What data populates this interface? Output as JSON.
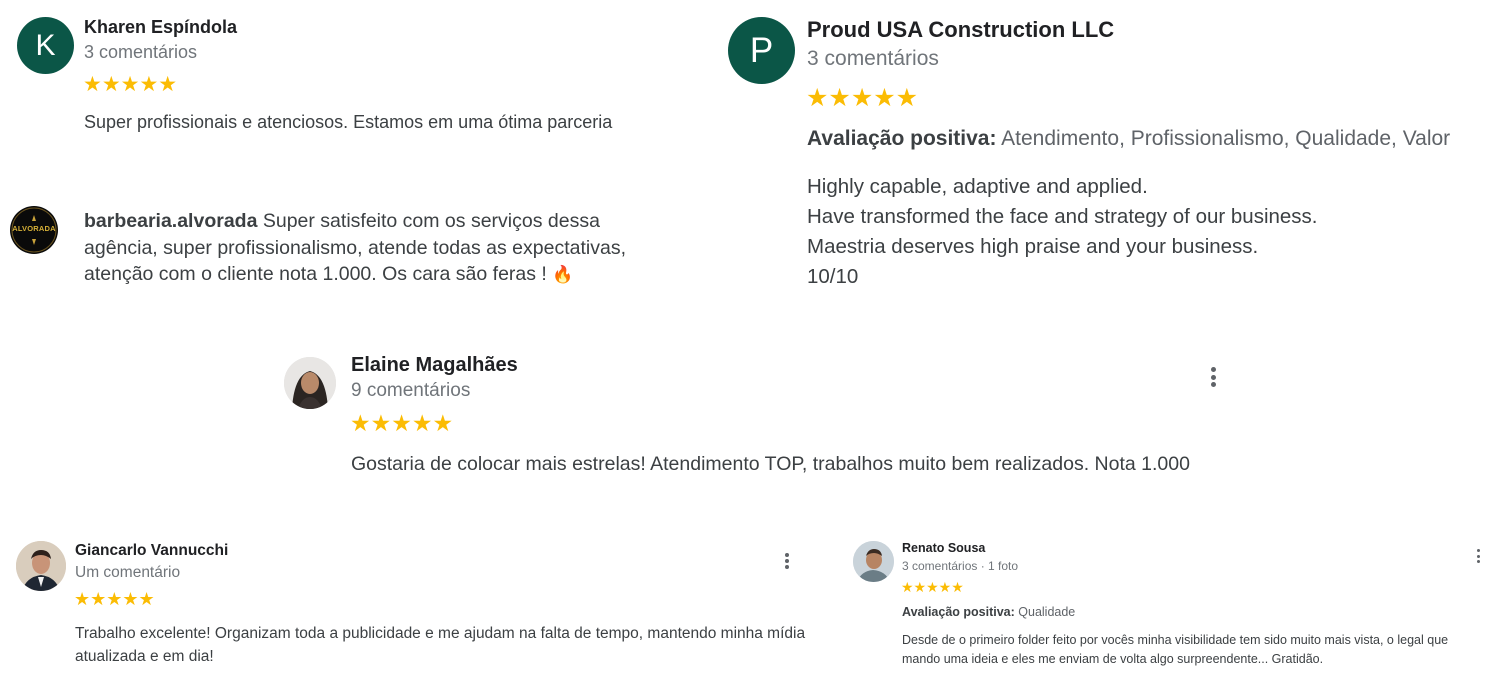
{
  "reviews": {
    "kharen": {
      "avatar_letter": "K",
      "name": "Kharen Espíndola",
      "meta": "3 comentários",
      "stars": "★★★★★",
      "text": "Super profissionais e atenciosos. Estamos em uma ótima parceria"
    },
    "proud": {
      "avatar_letter": "P",
      "name": "Proud USA Construction LLC",
      "meta": "3 comentários",
      "stars": "★★★★★",
      "positive_label": "Avaliação positiva:",
      "positive_value": "Atendimento, Profissionalismo, Qualidade, Valor",
      "lines": [
        "Highly capable, adaptive and applied.",
        "Have transformed the face and strategy of our business.",
        "Maestria deserves high praise and your business.",
        "10/10"
      ]
    },
    "barbearia": {
      "avatar_text": "ALVORADA",
      "name": "barbearia.alvorada",
      "text": " Super satisfeito com os serviços dessa agência, super profissionalismo, atende todas as expectativas, atenção com o cliente nota 1.000. Os cara são feras !",
      "emoji": "🔥"
    },
    "elaine": {
      "name": "Elaine Magalhães",
      "meta": "9 comentários",
      "stars": "★★★★★",
      "text": "Gostaria de colocar mais estrelas! Atendimento TOP, trabalhos muito bem realizados. Nota 1.000"
    },
    "giancarlo": {
      "name": "Giancarlo Vannucchi",
      "meta": "Um comentário",
      "stars": "★★★★★",
      "text": "Trabalho excelente! Organizam toda a publicidade e me ajudam na falta de tempo, mantendo minha mídia atualizada e em dia!"
    },
    "renato": {
      "name": "Renato Sousa",
      "meta": "3 comentários · 1 foto",
      "stars": "★★★★★",
      "positive_label": "Avaliação positiva:",
      "positive_value": "Qualidade",
      "text": "Desde de o primeiro folder feito por vocês minha visibilidade tem sido muito mais vista, o legal que mando uma ideia e eles me enviam de volta algo surpreendente... Gratidão."
    }
  },
  "colors": {
    "avatar_green": "#0b5647",
    "star": "#fbbc04",
    "meta_gray": "#70757a"
  },
  "icons": {
    "menu": "more-vert-icon"
  }
}
